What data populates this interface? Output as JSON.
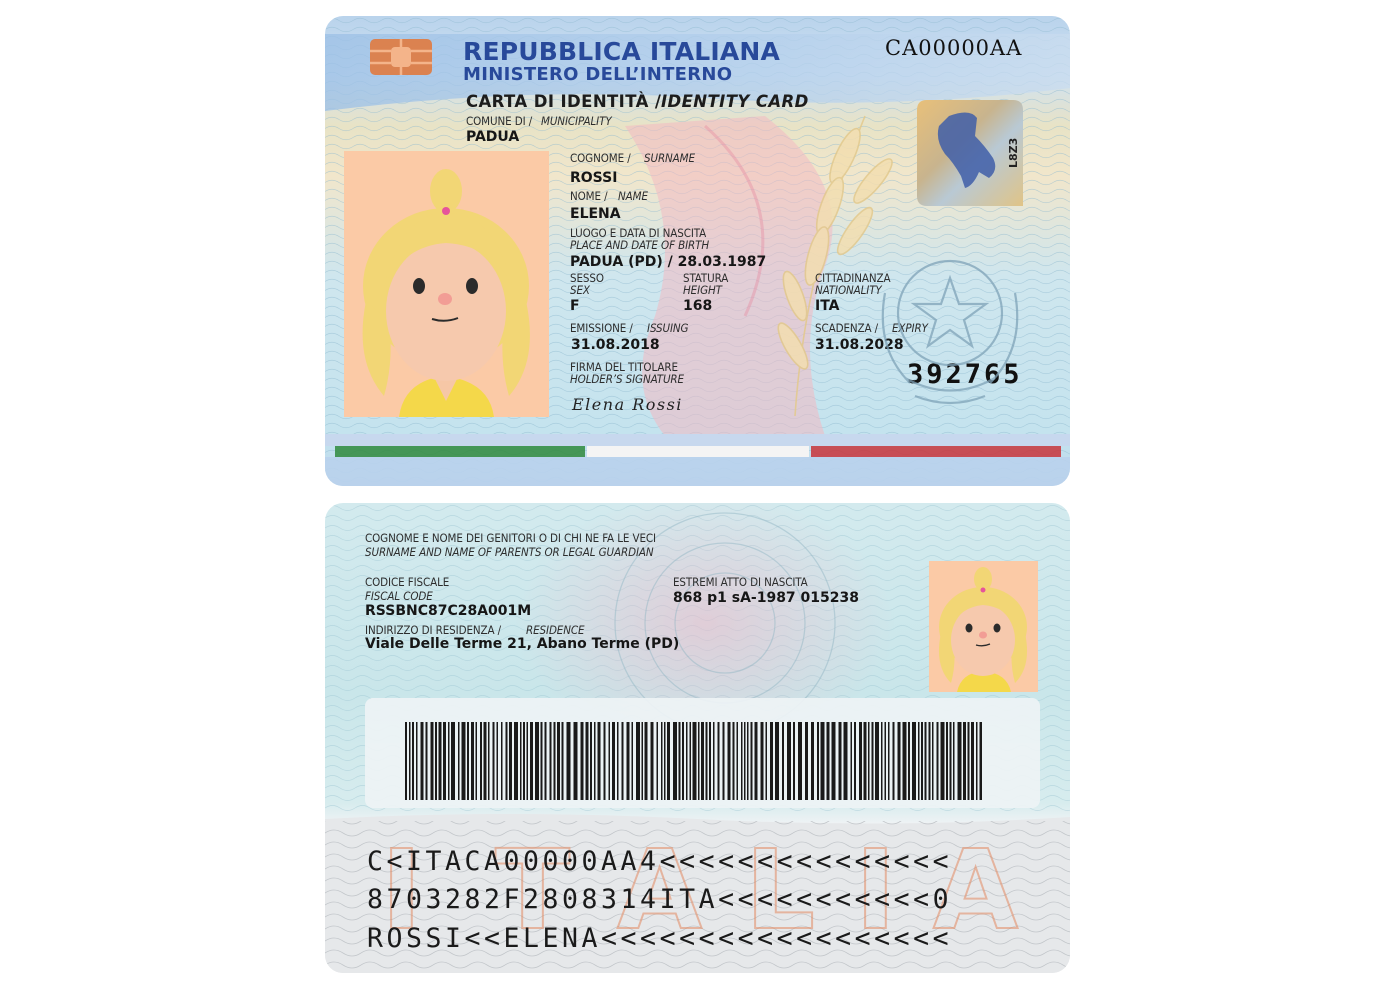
{
  "front": {
    "header_line1": "REPUBBLICA ITALIANA",
    "header_line2": "MINISTERO DELL’INTERNO",
    "document_number": "CA00000AA",
    "title_it": "CARTA DI IDENTITÀ /",
    "title_en": "IDENTITY CARD",
    "municipality": {
      "label_it": "COMUNE DI /",
      "label_en": "MUNICIPALITY",
      "value": "PADUA"
    },
    "surname": {
      "label_it": "COGNOME /",
      "label_en": "SURNAME",
      "value": "ROSSI"
    },
    "name": {
      "label_it": "NOME /",
      "label_en": "NAME",
      "value": "ELENA"
    },
    "birth": {
      "label_it": "LUOGO E DATA DI NASCITA",
      "label_en": "PLACE AND DATE OF BIRTH",
      "value": "PADUA (PD) / 28.03.1987"
    },
    "sex": {
      "label_it": "SESSO",
      "label_en": "SEX",
      "value": "F"
    },
    "height": {
      "label_it": "STATURA",
      "label_en": "HEIGHT",
      "value": "168"
    },
    "nationality": {
      "label_it": "CITTADINANZA",
      "label_en": "NATIONALITY",
      "value": "ITA"
    },
    "issuing": {
      "label_it": "EMISSIONE /",
      "label_en": "ISSUING",
      "value": "31.08.2018"
    },
    "expiry": {
      "label_it": "SCADENZA /",
      "label_en": "EXPIRY",
      "value": "31.08.2028"
    },
    "signature": {
      "label_it": "FIRMA DEL TITOLARE",
      "label_en": "HOLDER’S SIGNATURE",
      "value": "Elena Rossi"
    },
    "card_number": "392765",
    "hologram_code": "L8Z3"
  },
  "back": {
    "parents": {
      "label_it": "COGNOME E NOME DEI GENITORI O DI CHI NE FA LE VECI",
      "label_en": "SURNAME AND NAME OF PARENTS OR LEGAL GUARDIAN",
      "value": ""
    },
    "fiscal_code": {
      "label_it": "CODICE FISCALE",
      "label_en": "FISCAL CODE",
      "value": "RSSBNC87C28A001M"
    },
    "birth_record": {
      "label_it": "ESTREMI ATTO DI NASCITA",
      "value": "868 p1 sA-1987 015238"
    },
    "residence": {
      "label_it": "INDIRIZZO DI RESIDENZA /",
      "label_en": "RESIDENCE",
      "value": "Viale Delle Terme 21, Abano Terme (PD)"
    },
    "watermark": "ITALIA",
    "mrz": [
      "C<ITACA00000AA4<<<<<<<<<<<<<<<",
      "8703282F2808314ITA<<<<<<<<<<<0",
      "ROSSI<<ELENA<<<<<<<<<<<<<<<<<<"
    ]
  },
  "colors": {
    "header_blue": "#28499a",
    "flag_green": "#2f8a3c",
    "flag_white": "#f4f4f4",
    "flag_red": "#c8343a",
    "photo_background": "#fbcaa6",
    "hair": "#f2d675",
    "watermark_orange": "#e48b63"
  },
  "icons": [
    "chip-icon",
    "hologram-icon",
    "emblem-icon",
    "barcode-icon",
    "portrait-photo",
    "ghost-portrait-photo"
  ]
}
